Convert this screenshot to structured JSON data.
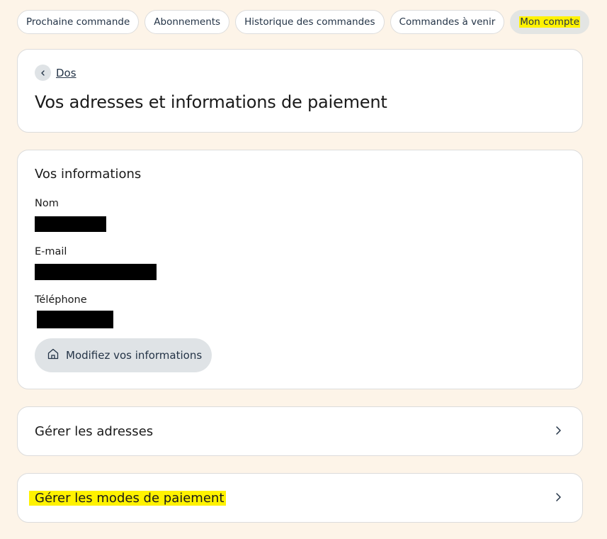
{
  "tabs": [
    {
      "label": "Prochaine commande"
    },
    {
      "label": "Abonnements"
    },
    {
      "label": "Historique des commandes"
    },
    {
      "label": "Commandes à venir"
    },
    {
      "label": "Mon compte"
    }
  ],
  "header": {
    "back_label": "Dos",
    "title": "Vos adresses et informations de paiement"
  },
  "info": {
    "section_title": "Vos informations",
    "name_label": "Nom",
    "email_label": "E-mail",
    "phone_label": "Téléphone",
    "edit_button": "Modifiez vos informations",
    "edit_icon": "home-icon"
  },
  "links": {
    "addresses": "Gérer les adresses",
    "payment": "Gérer les modes de paiement"
  },
  "colors": {
    "background": "#fdf4e8",
    "highlight": "#fff200",
    "button_bg": "#dfe3e6",
    "text_dark": "#243447"
  }
}
